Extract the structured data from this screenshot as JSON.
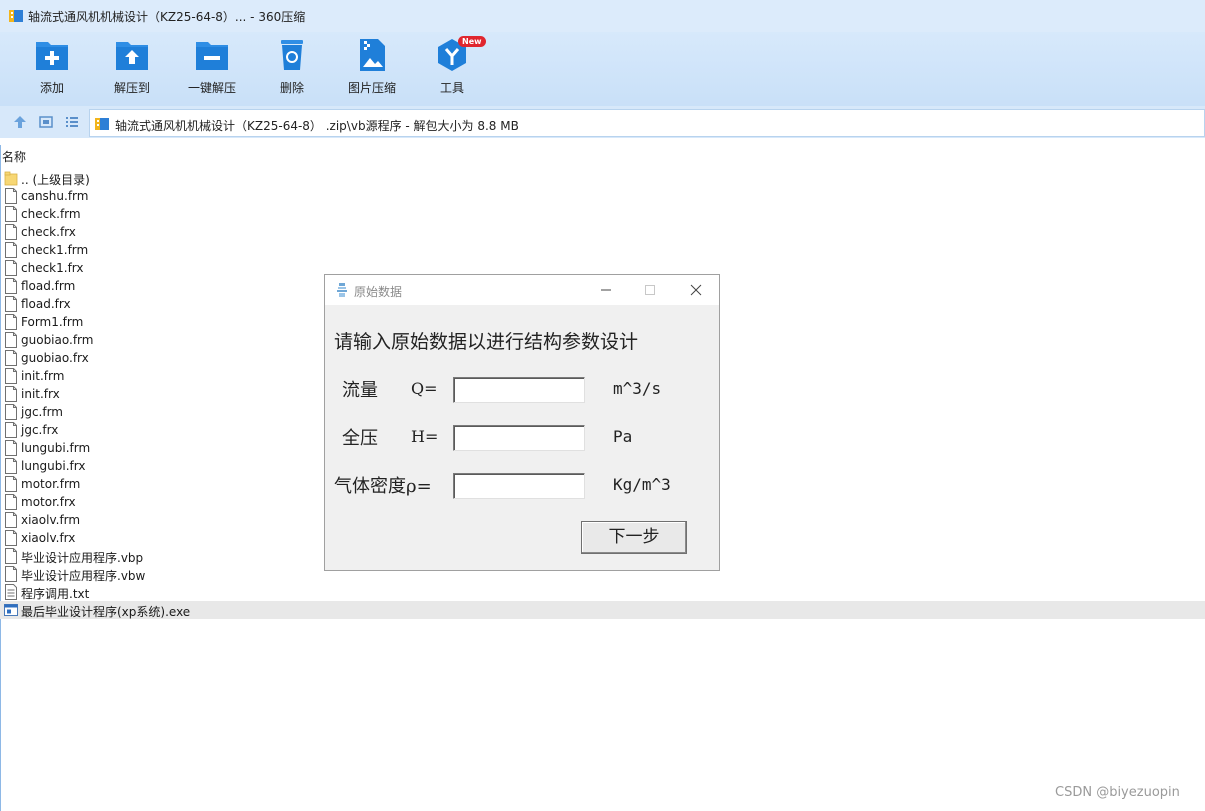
{
  "window": {
    "title": "轴流式通风机机械设计（KZ25-64-8）... - 360压缩"
  },
  "toolbar": {
    "buttons": [
      {
        "label": "添加",
        "icon": "add-icon"
      },
      {
        "label": "解压到",
        "icon": "extract-to-icon"
      },
      {
        "label": "一键解压",
        "icon": "one-click-extract-icon"
      },
      {
        "label": "删除",
        "icon": "recycle-bin-icon"
      },
      {
        "label": "图片压缩",
        "icon": "image-compress-icon"
      },
      {
        "label": "工具",
        "icon": "tools-icon",
        "badge": "New"
      }
    ]
  },
  "address": {
    "path": "轴流式通风机机械设计（KZ25-64-8）  .zip\\vb源程序 - 解包大小为 8.8 MB"
  },
  "filelist": {
    "column_name": "名称",
    "files": [
      {
        "name": ".. (上级目录)",
        "type": "folder"
      },
      {
        "name": "canshu.frm",
        "type": "file"
      },
      {
        "name": "check.frm",
        "type": "file"
      },
      {
        "name": "check.frx",
        "type": "file"
      },
      {
        "name": "check1.frm",
        "type": "file"
      },
      {
        "name": "check1.frx",
        "type": "file"
      },
      {
        "name": "fload.frm",
        "type": "file"
      },
      {
        "name": "fload.frx",
        "type": "file"
      },
      {
        "name": "Form1.frm",
        "type": "file"
      },
      {
        "name": "guobiao.frm",
        "type": "file"
      },
      {
        "name": "guobiao.frx",
        "type": "file"
      },
      {
        "name": "init.frm",
        "type": "file"
      },
      {
        "name": "init.frx",
        "type": "file"
      },
      {
        "name": "jgc.frm",
        "type": "file"
      },
      {
        "name": "jgc.frx",
        "type": "file"
      },
      {
        "name": "lungubi.frm",
        "type": "file"
      },
      {
        "name": "lungubi.frx",
        "type": "file"
      },
      {
        "name": "motor.frm",
        "type": "file"
      },
      {
        "name": "motor.frx",
        "type": "file"
      },
      {
        "name": "xiaolv.frm",
        "type": "file"
      },
      {
        "name": "xiaolv.frx",
        "type": "file"
      },
      {
        "name": "毕业设计应用程序.vbp",
        "type": "file"
      },
      {
        "name": "毕业设计应用程序.vbw",
        "type": "file"
      },
      {
        "name": "程序调用.txt",
        "type": "text"
      },
      {
        "name": "最后毕业设计程序(xp系统).exe",
        "type": "exe",
        "selected": true
      }
    ]
  },
  "dialog": {
    "title": "原始数据",
    "prompt": "请输入原始数据以进行结构参数设计",
    "flow": {
      "label": "流量",
      "symbol": "Q=",
      "unit": "m^3/s",
      "value": ""
    },
    "pressure": {
      "label": "全压",
      "symbol": "H=",
      "unit": "Pa",
      "value": ""
    },
    "density": {
      "label": "气体密度ρ=",
      "unit": "Kg/m^3",
      "value": ""
    },
    "next_label": "下一步"
  },
  "watermark": "CSDN @biyezuopin"
}
